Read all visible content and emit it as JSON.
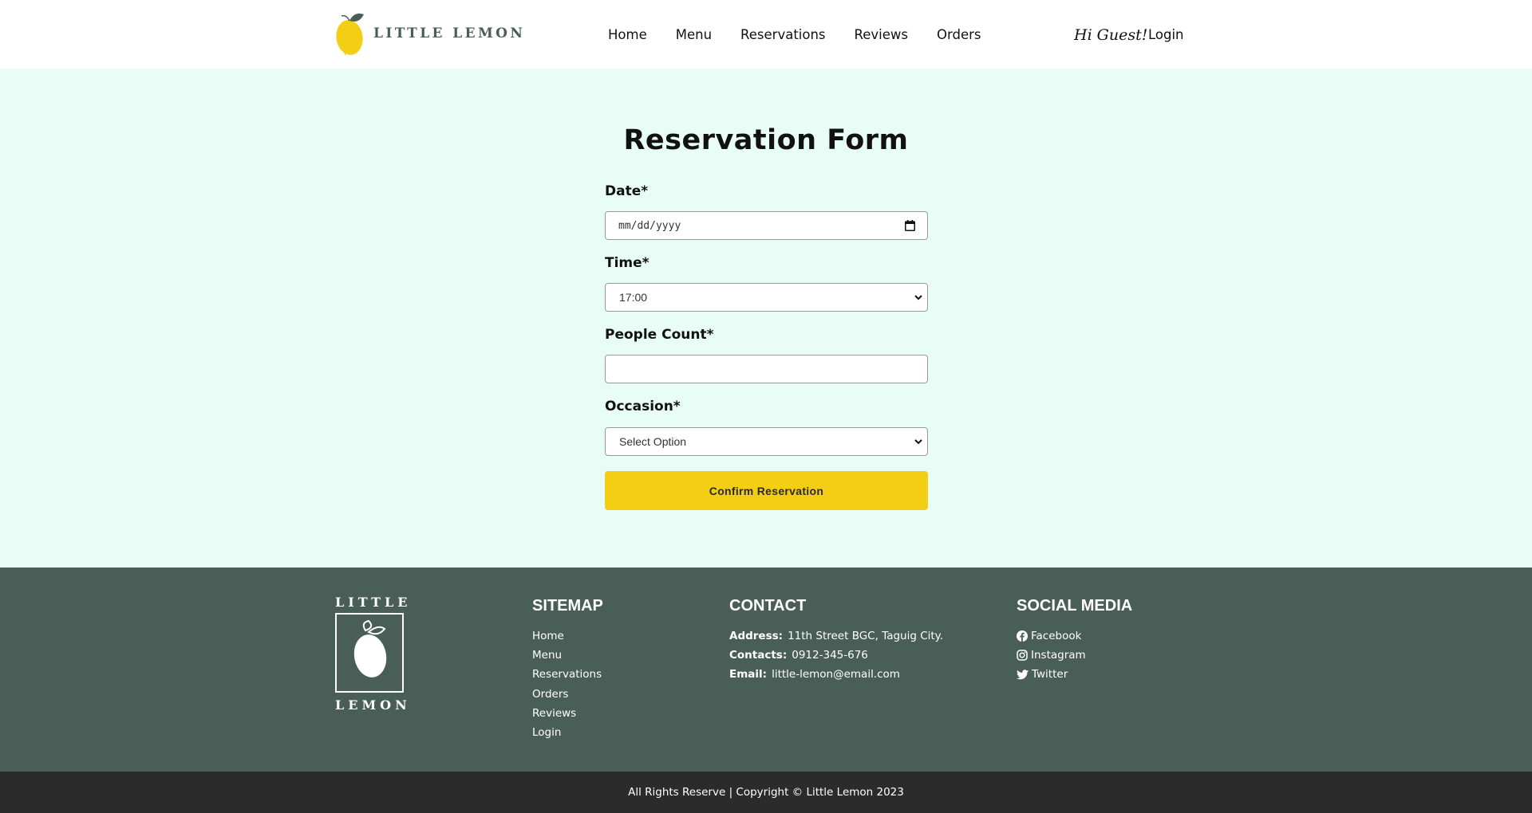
{
  "header": {
    "logo_text": "LITTLE LEMON",
    "nav": [
      "Home",
      "Menu",
      "Reservations",
      "Reviews",
      "Orders"
    ],
    "greeting": "Hi Guest!",
    "login": "Login"
  },
  "form": {
    "title": "Reservation Form",
    "date": {
      "label": "Date*",
      "placeholder": "mm/dd/yyyy"
    },
    "time": {
      "label": "Time*",
      "value": "17:00"
    },
    "people": {
      "label": "People Count*",
      "value": ""
    },
    "occasion": {
      "label": "Occasion*",
      "value": "Select Option"
    },
    "submit": "Confirm Reservation"
  },
  "footer": {
    "logo_top": "LITTLE",
    "logo_bottom": "LEMON",
    "sitemap": {
      "title": "SITEMAP",
      "items": [
        "Home",
        "Menu",
        "Reservations",
        "Orders",
        "Reviews",
        "Login"
      ]
    },
    "contact": {
      "title": "CONTACT",
      "address_label": "Address:",
      "address": "11th Street BGC, Taguig City.",
      "contacts_label": "Contacts:",
      "contacts": "0912-345-676",
      "email_label": "Email:",
      "email": "little-lemon@email.com"
    },
    "social": {
      "title": "SOCIAL MEDIA",
      "items": [
        "Facebook",
        "Instagram",
        "Twitter"
      ]
    },
    "copyright": "All Rights Reserve | Copyright © Little Lemon 2023"
  },
  "colors": {
    "brand_green": "#495e57",
    "brand_yellow": "#f4ce14",
    "page_bg": "#e8fdf6",
    "bottom_bar": "#2b2b2b"
  }
}
